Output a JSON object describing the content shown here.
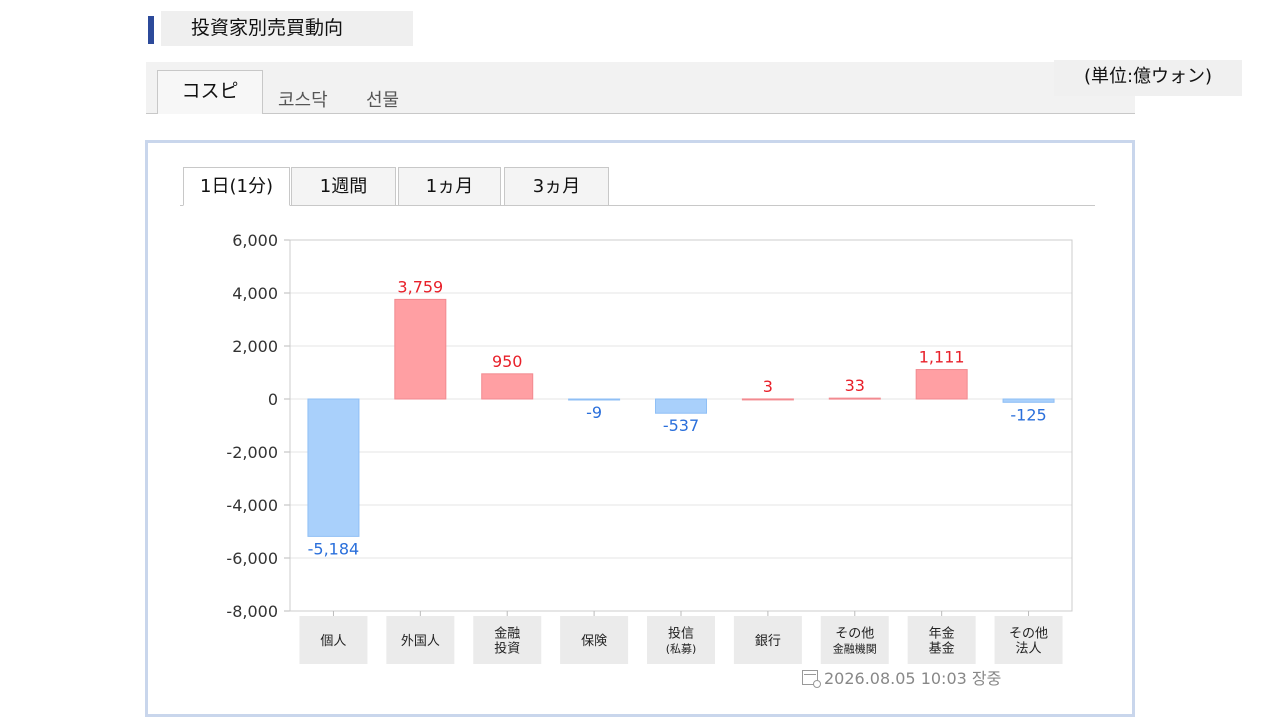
{
  "header": {
    "title": "投資家別売買動向",
    "unit": "(単位:億ウォン)"
  },
  "market_tabs": [
    {
      "label": "コスピ",
      "active": true
    },
    {
      "label": "코스닥",
      "active": false
    },
    {
      "label": "선물",
      "active": false
    }
  ],
  "period_tabs": [
    {
      "label": "1日(1分)",
      "active": true
    },
    {
      "label": "1週間",
      "active": false
    },
    {
      "label": "1ヵ月",
      "active": false
    },
    {
      "label": "3ヵ月",
      "active": false
    }
  ],
  "timestamp": "2026.08.05 10:03 장중",
  "colors": {
    "positive": "#ff9fa3",
    "negative": "#a9d0fb",
    "positive_text": "#e8202a",
    "negative_text": "#2a6fdb"
  },
  "chart_data": {
    "type": "bar",
    "categories": [
      [
        "個人"
      ],
      [
        "外国人"
      ],
      [
        "金融",
        "投資"
      ],
      [
        "保険"
      ],
      [
        "投信",
        "(私募)"
      ],
      [
        "銀行"
      ],
      [
        "その他",
        "金融機関"
      ],
      [
        "年金",
        "基金"
      ],
      [
        "その他",
        "法人"
      ]
    ],
    "values": [
      -5184,
      3759,
      950,
      -9,
      -537,
      3,
      33,
      1111,
      -125
    ],
    "value_labels": [
      "-5,184",
      "3,759",
      "950",
      "-9",
      "-537",
      "3",
      "33",
      "1,111",
      "-125"
    ],
    "ylim": [
      -8000,
      6000
    ],
    "yticks": [
      6000,
      4000,
      2000,
      0,
      -2000,
      -4000,
      -6000,
      -8000
    ],
    "ytick_labels": [
      "6,000",
      "4,000",
      "2,000",
      "0",
      "-2,000",
      "-4,000",
      "-6,000",
      "-8,000"
    ],
    "grid": true
  }
}
